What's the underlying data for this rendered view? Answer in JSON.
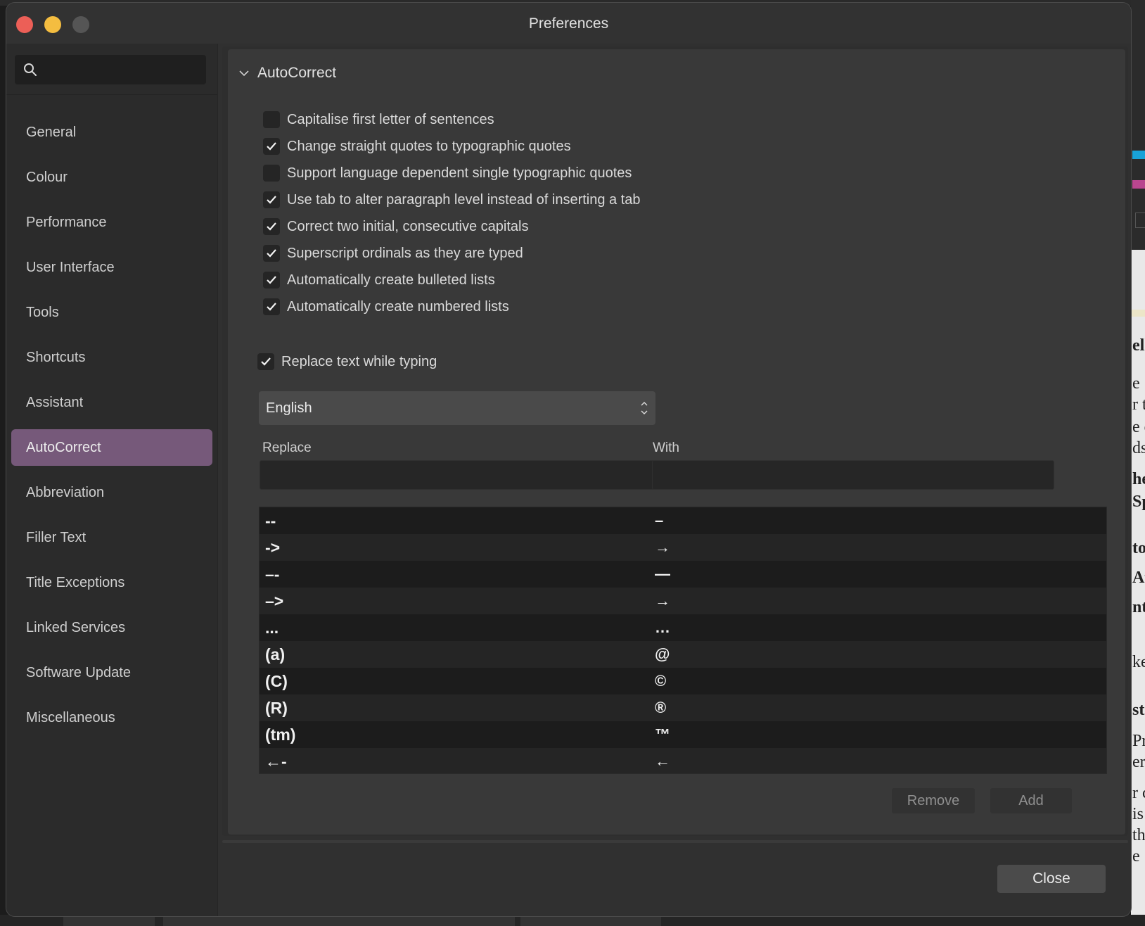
{
  "window": {
    "title": "Preferences"
  },
  "sidebar": {
    "search": {
      "placeholder": "",
      "value": ""
    },
    "items": [
      {
        "label": "General"
      },
      {
        "label": "Colour"
      },
      {
        "label": "Performance"
      },
      {
        "label": "User Interface"
      },
      {
        "label": "Tools"
      },
      {
        "label": "Shortcuts"
      },
      {
        "label": "Assistant"
      },
      {
        "label": "AutoCorrect",
        "selected": true
      },
      {
        "label": "Abbreviation"
      },
      {
        "label": "Filler Text"
      },
      {
        "label": "Title Exceptions"
      },
      {
        "label": "Linked Services"
      },
      {
        "label": "Software Update"
      },
      {
        "label": "Miscellaneous"
      }
    ]
  },
  "autocorrect": {
    "section_title": "AutoCorrect",
    "options": [
      {
        "label": "Capitalise first letter of sentences",
        "checked": false
      },
      {
        "label": "Change straight quotes to typographic quotes",
        "checked": true
      },
      {
        "label": "Support language dependent single typographic quotes",
        "checked": false
      },
      {
        "label": "Use tab to alter paragraph level instead of inserting a tab",
        "checked": true
      },
      {
        "label": "Correct two initial, consecutive capitals",
        "checked": true
      },
      {
        "label": "Superscript ordinals as they are typed",
        "checked": true
      },
      {
        "label": "Automatically create bulleted lists",
        "checked": true
      },
      {
        "label": "Automatically create numbered lists",
        "checked": true
      }
    ],
    "replace_while_typing": {
      "label": "Replace text while typing",
      "checked": true
    },
    "language": {
      "selected": "English"
    },
    "replace_label": "Replace",
    "with_label": "With",
    "replace_value": "",
    "with_value": "",
    "table": [
      {
        "replace": "--",
        "with": "–"
      },
      {
        "replace": "->",
        "with": "→"
      },
      {
        "replace": "–-",
        "with": "—"
      },
      {
        "replace": "–>",
        "with": "→"
      },
      {
        "replace": "...",
        "with": "…"
      },
      {
        "replace": "(a)",
        "with": "@"
      },
      {
        "replace": "(C)",
        "with": "©"
      },
      {
        "replace": "(R)",
        "with": "®"
      },
      {
        "replace": "(tm)",
        "with": "™"
      },
      {
        "replace": "←-",
        "with": "←"
      }
    ],
    "remove_label": "Remove",
    "add_label": "Add"
  },
  "footer": {
    "close_label": "Close"
  },
  "background_fragments": [
    "ell",
    "e",
    "r t",
    "e c",
    "ds",
    "he",
    "Sp",
    "to",
    "Af",
    "nto",
    "ke",
    "st",
    "Pr",
    "er",
    "r c",
    "is",
    "th",
    "e"
  ]
}
